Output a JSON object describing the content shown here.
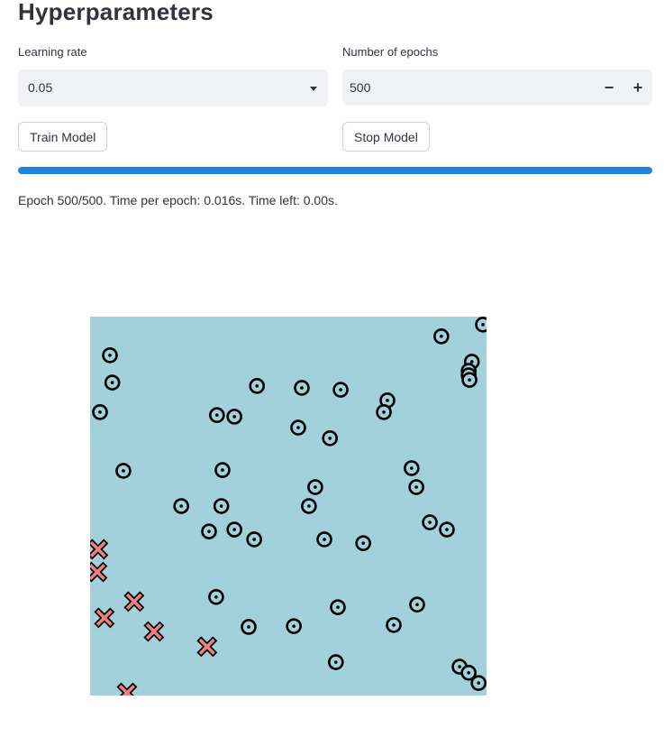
{
  "header": {
    "title": "Hyperparameters"
  },
  "learning_rate": {
    "label": "Learning rate",
    "value": "0.05"
  },
  "epochs": {
    "label": "Number of epochs",
    "value": "500",
    "minus_glyph": "−",
    "plus_glyph": "+"
  },
  "buttons": {
    "train_label": "Train Model",
    "stop_label": "Stop Model"
  },
  "progress": {
    "fraction": 1.0,
    "color": "#1c83e1"
  },
  "status": {
    "text": "Epoch 500/500. Time per epoch: 0.016s. Time left: 0.00s."
  },
  "colors": {
    "plot_background": "#a2d1db",
    "circle_marker_fill": "#a2d1db",
    "cross_marker_fill": "#f08080",
    "marker_outline": "#000000"
  },
  "chart_data": {
    "type": "scatter",
    "title": "",
    "xlabel": "",
    "ylabel": "",
    "xlim": [
      0,
      1
    ],
    "ylim": [
      0,
      1
    ],
    "grid": false,
    "background_color": "#a2d1db",
    "series": [
      {
        "marker": "circle",
        "points": [
          [
            0.991,
            0.979
          ],
          [
            0.886,
            0.948
          ],
          [
            0.05,
            0.898
          ],
          [
            0.963,
            0.881
          ],
          [
            0.955,
            0.857
          ],
          [
            0.955,
            0.845
          ],
          [
            0.957,
            0.833
          ],
          [
            0.056,
            0.826
          ],
          [
            0.421,
            0.817
          ],
          [
            0.534,
            0.812
          ],
          [
            0.632,
            0.807
          ],
          [
            0.75,
            0.779
          ],
          [
            0.741,
            0.748
          ],
          [
            0.025,
            0.748
          ],
          [
            0.32,
            0.74
          ],
          [
            0.364,
            0.736
          ],
          [
            0.525,
            0.707
          ],
          [
            0.605,
            0.679
          ],
          [
            0.084,
            0.593
          ],
          [
            0.334,
            0.595
          ],
          [
            0.811,
            0.6
          ],
          [
            0.823,
            0.55
          ],
          [
            0.568,
            0.55
          ],
          [
            0.23,
            0.5
          ],
          [
            0.331,
            0.5
          ],
          [
            0.552,
            0.5
          ],
          [
            0.857,
            0.457
          ],
          [
            0.9,
            0.438
          ],
          [
            0.3,
            0.433
          ],
          [
            0.364,
            0.438
          ],
          [
            0.414,
            0.412
          ],
          [
            0.591,
            0.412
          ],
          [
            0.689,
            0.402
          ],
          [
            0.318,
            0.26
          ],
          [
            0.625,
            0.233
          ],
          [
            0.825,
            0.24
          ],
          [
            0.4,
            0.181
          ],
          [
            0.514,
            0.183
          ],
          [
            0.766,
            0.186
          ],
          [
            0.62,
            0.088
          ],
          [
            0.932,
            0.076
          ],
          [
            0.955,
            0.06
          ],
          [
            0.98,
            0.033
          ]
        ]
      },
      {
        "marker": "x",
        "points": [
          [
            0.02,
            0.386
          ],
          [
            0.018,
            0.326
          ],
          [
            0.111,
            0.248
          ],
          [
            0.036,
            0.205
          ],
          [
            0.161,
            0.169
          ],
          [
            0.295,
            0.129
          ],
          [
            0.093,
            0.007
          ]
        ]
      }
    ]
  }
}
